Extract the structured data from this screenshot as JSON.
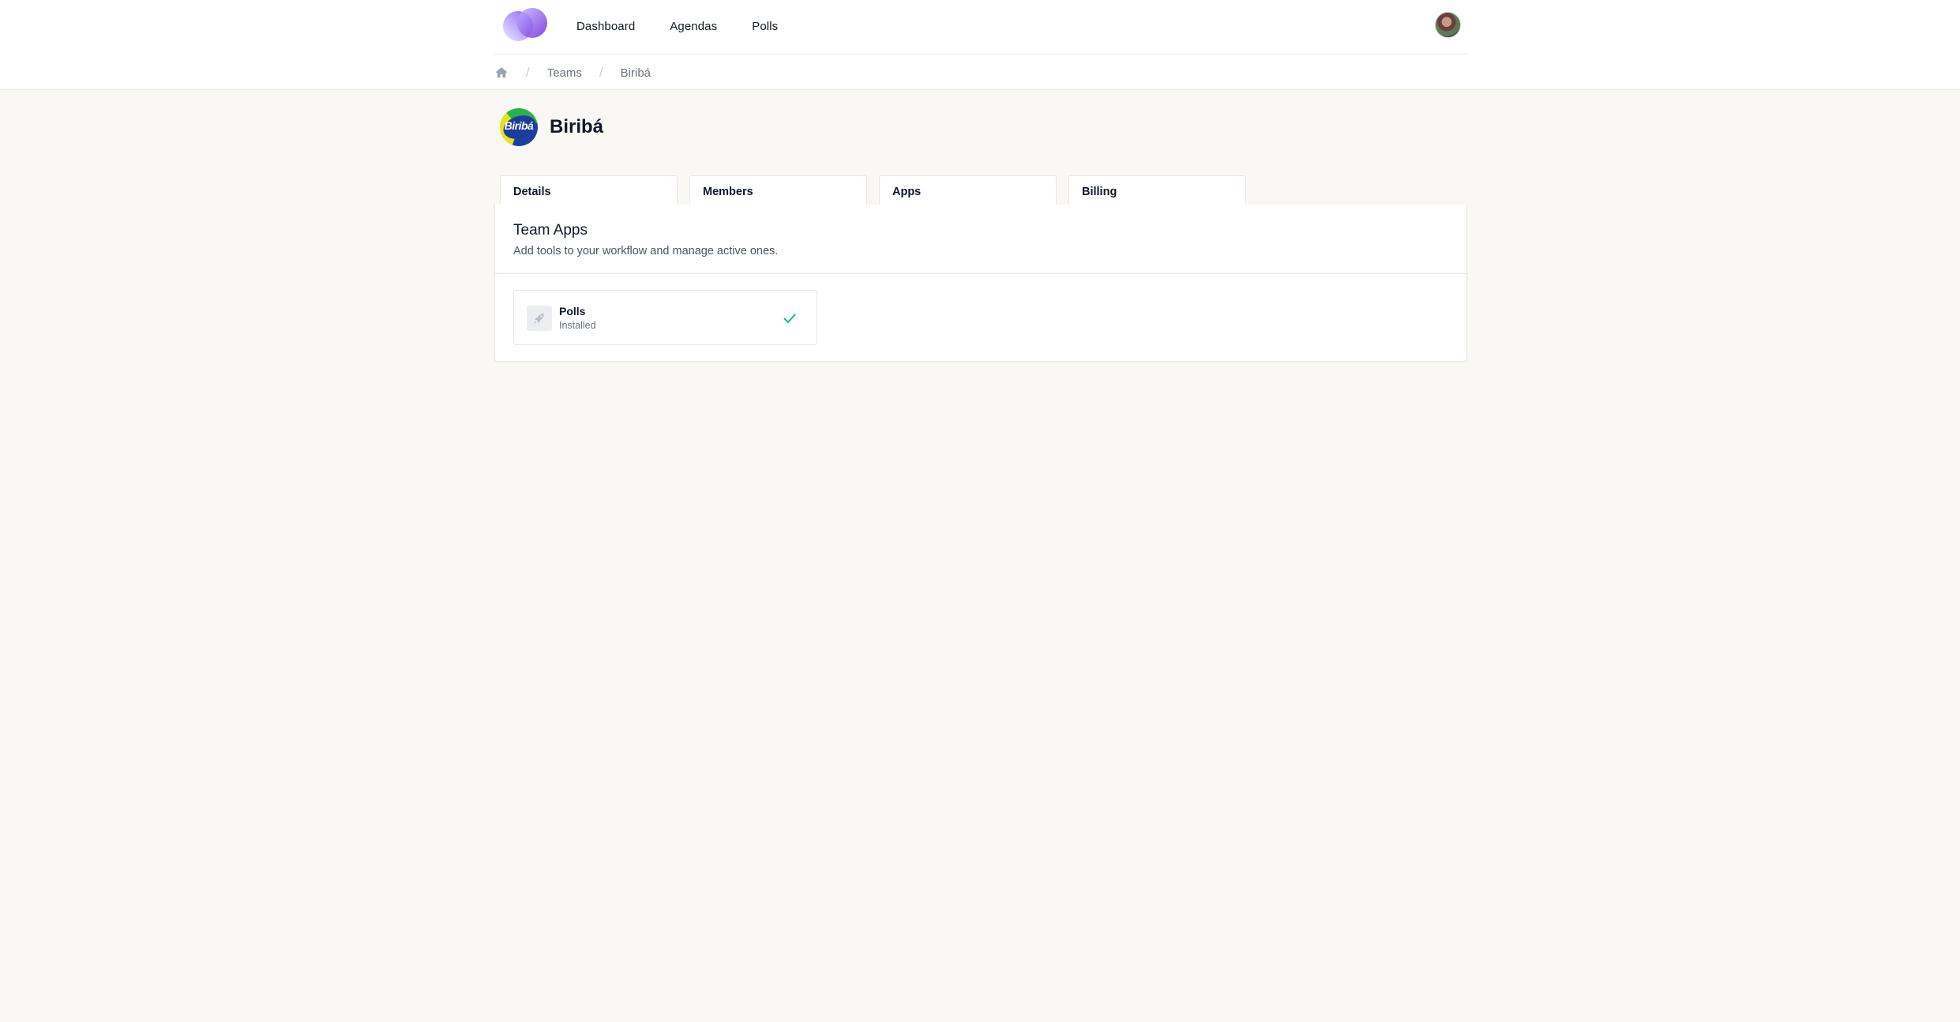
{
  "nav": {
    "links": [
      {
        "label": "Dashboard"
      },
      {
        "label": "Agendas"
      },
      {
        "label": "Polls"
      }
    ],
    "logo_icon": "brand-logo-icon",
    "avatar_icon": "user-avatar"
  },
  "breadcrumb": {
    "home_icon": "home-icon",
    "items": [
      "Teams",
      "Biribá"
    ]
  },
  "team": {
    "name": "Biribá",
    "logo_text": "Biribá"
  },
  "tabs": [
    {
      "label": "Details"
    },
    {
      "label": "Members"
    },
    {
      "label": "Apps"
    },
    {
      "label": "Billing"
    }
  ],
  "apps_section": {
    "title": "Team Apps",
    "description": "Add tools to your workflow and manage active ones.",
    "apps": [
      {
        "name": "Polls",
        "status": "Installed",
        "icon": "rocket-icon",
        "status_icon": "check-icon",
        "status_color": "#10b981"
      }
    ]
  },
  "colors": {
    "page_bg": "#f9f8f4",
    "brand_purple": "#8b5cf6",
    "success": "#10b981"
  }
}
